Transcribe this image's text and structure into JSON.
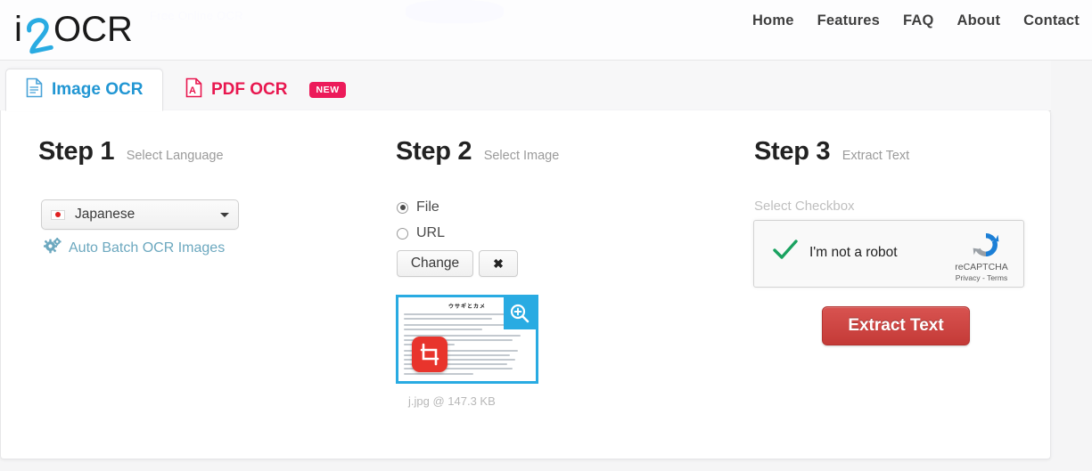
{
  "header": {
    "logo_text": "i2OCR",
    "ghost_tagline": "Free Online OCR",
    "nav": [
      {
        "label": "Home"
      },
      {
        "label": "Features"
      },
      {
        "label": "FAQ"
      },
      {
        "label": "About"
      },
      {
        "label": "Contact"
      }
    ]
  },
  "tabs": [
    {
      "label": "Image OCR",
      "icon": "image-document-icon",
      "active": true
    },
    {
      "label": "PDF OCR",
      "icon": "pdf-document-icon",
      "badge": "NEW",
      "active": false
    }
  ],
  "step1": {
    "title": "Step 1",
    "subtitle": "Select Language",
    "language_selected": "Japanese",
    "language_flag": "japan-flag-icon",
    "batch_link": "Auto Batch OCR Images",
    "batch_icon": "gears-icon",
    "link_color": "#6ca8bf"
  },
  "step2": {
    "title": "Step 2",
    "subtitle": "Select Image",
    "source_options": [
      {
        "label": "File",
        "selected": true
      },
      {
        "label": "URL",
        "selected": false
      }
    ],
    "change_button": "Change",
    "clear_button": "✖",
    "thumbnail": {
      "doc_title": "ウサギとカメ",
      "zoom_icon": "magnifier-plus-icon",
      "crop_icon": "crop-icon",
      "border_color": "#29abe2"
    },
    "file_caption": "j.jpg @ 147.3 KB"
  },
  "step3": {
    "title": "Step 3",
    "subtitle": "Extract Text",
    "checkbox_label": "Select Checkbox",
    "recaptcha": {
      "checkbox_state": "checked",
      "text": "I'm not a robot",
      "brand": "reCAPTCHA",
      "links": "Privacy - Terms"
    },
    "extract_button": "Extract Text",
    "extract_button_color": "#c43a37"
  }
}
